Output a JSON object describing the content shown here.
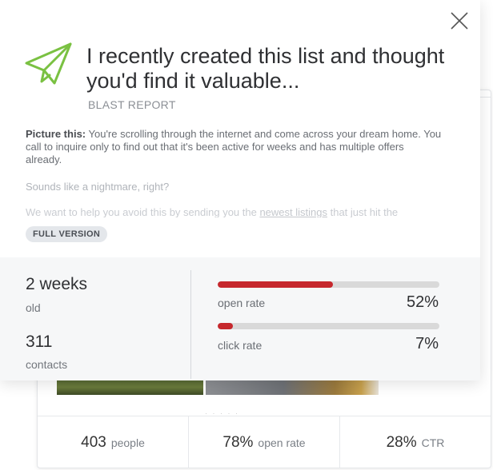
{
  "modal": {
    "title": "I recently created this list and thought you'd find it valuable...",
    "subtitle": "BLAST REPORT",
    "description_bold": "Picture this:",
    "description": " You're scrolling through the internet and come across your dream home. You call to inquire only to find out that it's been active for weeks and has multiple offers already.",
    "faded_line_1": "Sounds like a nightmare, right?",
    "faded_line_2_prefix": "We want to help you avoid this by sending you the ",
    "faded_line_2_link": "newest listings",
    "faded_line_2_suffix": " that just hit the",
    "badge": "FULL VERSION",
    "icons": {
      "close": "close-icon",
      "send": "paper-plane-icon"
    }
  },
  "stats": {
    "age_value": "2 weeks",
    "age_label": "old",
    "contacts_value": "311",
    "contacts_label": "contacts",
    "open_rate": {
      "label": "open rate",
      "value": "52%",
      "fraction": 0.52
    },
    "click_rate": {
      "label": "click rate",
      "value": "7%",
      "fraction": 0.07
    },
    "bar_color": "#c6282d",
    "accent_green": "#7ac142"
  },
  "background_card": {
    "stats": [
      {
        "num": "403",
        "label": "people"
      },
      {
        "num": "78%",
        "label": "open rate"
      },
      {
        "num": "28%",
        "label": "CTR"
      }
    ]
  }
}
